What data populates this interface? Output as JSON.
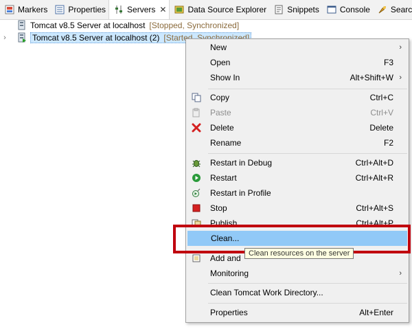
{
  "tabs": [
    {
      "label": "Markers",
      "icon": "markers-icon"
    },
    {
      "label": "Properties",
      "icon": "properties-icon"
    },
    {
      "label": "Servers",
      "icon": "servers-icon",
      "active": true
    },
    {
      "label": "Data Source Explorer",
      "icon": "data-source-icon"
    },
    {
      "label": "Snippets",
      "icon": "snippets-icon"
    },
    {
      "label": "Console",
      "icon": "console-icon"
    },
    {
      "label": "Search",
      "icon": "search-icon"
    }
  ],
  "servers": [
    {
      "name": "Tomcat v8.5 Server at localhost",
      "state": "[Stopped, Synchronized]"
    },
    {
      "name": "Tomcat v8.5 Server at localhost (2)",
      "state": "[Started, Synchronized]"
    }
  ],
  "menu": {
    "new": {
      "label": "New"
    },
    "open": {
      "label": "Open",
      "key": "F3"
    },
    "show_in": {
      "label": "Show In",
      "key": "Alt+Shift+W"
    },
    "copy": {
      "label": "Copy",
      "key": "Ctrl+C"
    },
    "paste": {
      "label": "Paste",
      "key": "Ctrl+V"
    },
    "delete": {
      "label": "Delete",
      "key": "Delete"
    },
    "rename": {
      "label": "Rename",
      "key": "F2"
    },
    "restart_debug": {
      "label": "Restart in Debug",
      "key": "Ctrl+Alt+D"
    },
    "restart": {
      "label": "Restart",
      "key": "Ctrl+Alt+R"
    },
    "restart_profile": {
      "label": "Restart in Profile"
    },
    "stop": {
      "label": "Stop",
      "key": "Ctrl+Alt+S"
    },
    "publish": {
      "label": "Publish",
      "key": "Ctrl+Alt+P"
    },
    "clean": {
      "label": "Clean..."
    },
    "add_remove": {
      "label": "Add and"
    },
    "monitoring": {
      "label": "Monitoring"
    },
    "clean_work": {
      "label": "Clean Tomcat Work Directory..."
    },
    "properties": {
      "label": "Properties",
      "key": "Alt+Enter"
    }
  },
  "tooltip": "Clean resources on the server",
  "colors": {
    "highlight": "#c0000e",
    "menu_hover": "#91c9f7",
    "selection": "#cce8ff"
  }
}
